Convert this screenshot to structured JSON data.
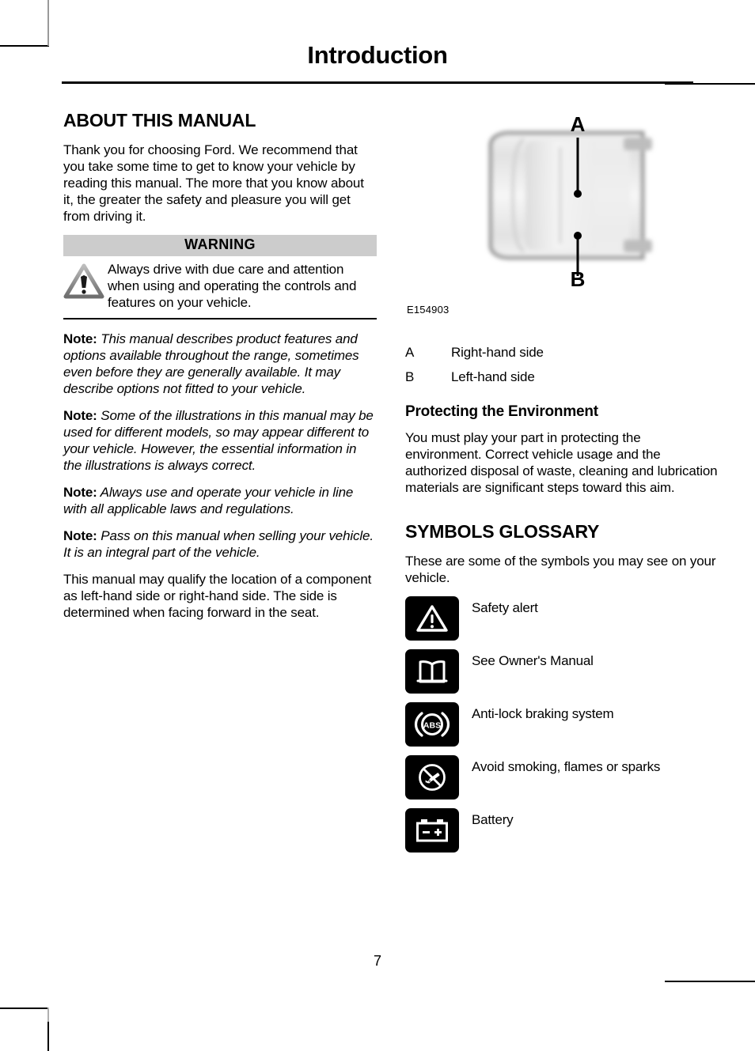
{
  "page": {
    "chapter_title": "Introduction",
    "page_number": "7"
  },
  "left_column": {
    "section_heading": "ABOUT THIS MANUAL",
    "intro_paragraph": "Thank you for choosing Ford. We recommend that you take some time to get to know your vehicle by reading this manual. The more that you know about it, the greater the safety and pleasure you will get from driving it.",
    "warning": {
      "banner_label": "WARNING",
      "icon": "warning-triangle-icon",
      "text": "Always drive with due care and attention when using and operating the controls and features on your vehicle."
    },
    "notes": [
      {
        "label": "Note:",
        "text": "This manual describes product features and options available throughout the range, sometimes even before they are generally available. It may describe options not fitted to your vehicle."
      },
      {
        "label": "Note:",
        "text": "Some of the illustrations in this manual may be used for different models, so may appear different to your vehicle. However, the essential information in the illustrations is always correct."
      },
      {
        "label": "Note:",
        "text": "Always use and operate your vehicle in line with all applicable laws and regulations."
      },
      {
        "label": "Note:",
        "text": "Pass on this manual when selling your vehicle. It is an integral part of the vehicle."
      }
    ],
    "closing_paragraph": "This manual may qualify the location of a component as left-hand side or right-hand side. The side is determined when facing forward in the seat."
  },
  "right_column": {
    "illustration": {
      "image_reference": "E154903",
      "callout_top_label": "A",
      "callout_bottom_label": "B",
      "alt": "vehicle-top-view-diagram"
    },
    "callouts": [
      {
        "key": "A",
        "description": "Right-hand side"
      },
      {
        "key": "B",
        "description": "Left-hand side"
      }
    ],
    "environment": {
      "heading": "Protecting the Environment",
      "text": "You must play your part in protecting the environment. Correct vehicle usage and the authorized disposal of waste, cleaning and lubrication materials are significant steps toward this aim."
    },
    "symbols_glossary": {
      "heading": "SYMBOLS GLOSSARY",
      "intro": "These are some of the symbols you may see on your vehicle.",
      "items": [
        {
          "icon": "safety-alert-icon",
          "label": "Safety alert"
        },
        {
          "icon": "owners-manual-icon",
          "label": "See Owner's Manual"
        },
        {
          "icon": "abs-icon",
          "label": "Anti-lock braking system"
        },
        {
          "icon": "no-smoking-icon",
          "label": "Avoid smoking, flames or sparks"
        },
        {
          "icon": "battery-icon",
          "label": "Battery"
        }
      ]
    }
  },
  "colors": {
    "warning_banner_bg": "#cccccc",
    "icon_badge_bg": "#000000",
    "text": "#000000"
  }
}
